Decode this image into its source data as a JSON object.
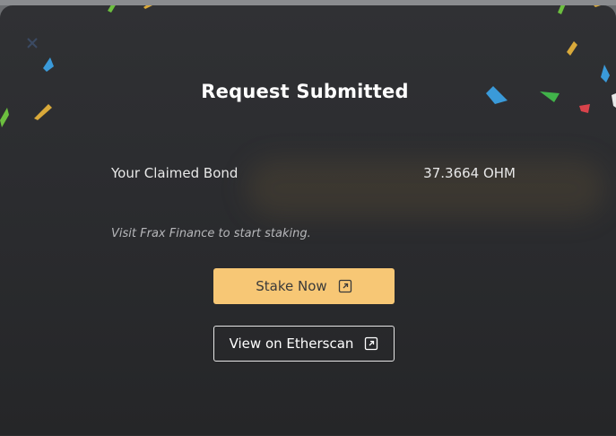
{
  "modal": {
    "title": "Request Submitted",
    "claimed_bond_label": "Your Claimed Bond",
    "claimed_bond_value": "37.3664 OHM",
    "hint": "Visit Frax Finance to start staking.",
    "stake_button_label": "Stake Now",
    "etherscan_button_label": "View on Etherscan"
  },
  "icons": {
    "close": "close-icon",
    "external": "external-link-icon"
  },
  "colors": {
    "accent": "#f7c775",
    "text": "#ffffff",
    "muted": "#b6b7ba"
  }
}
